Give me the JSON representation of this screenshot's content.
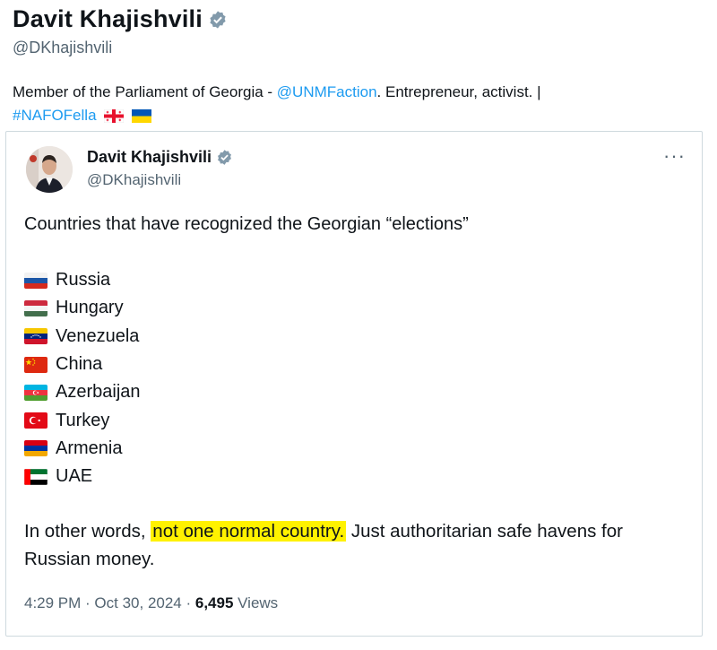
{
  "profile": {
    "name": "Davit Khajishvili",
    "handle": "@DKhajishvili",
    "bio_text1": "Member of the Parliament of Georgia - ",
    "bio_mention": "@UNMFaction",
    "bio_text2": ". Entrepreneur, activist. |",
    "bio_hashtag": "#NAFOFella"
  },
  "tweet": {
    "author_name": "Davit Khajishvili",
    "author_handle": "@DKhajishvili",
    "more_label": "···",
    "intro": "Countries that have recognized the Georgian “elections”",
    "countries": [
      {
        "name": "Russia",
        "flag": "russia-flag-icon"
      },
      {
        "name": "Hungary",
        "flag": "hungary-flag-icon"
      },
      {
        "name": "Venezuela",
        "flag": "venezuela-flag-icon"
      },
      {
        "name": "China",
        "flag": "china-flag-icon"
      },
      {
        "name": "Azerbaijan",
        "flag": "azerbaijan-flag-icon"
      },
      {
        "name": "Turkey",
        "flag": "turkey-flag-icon"
      },
      {
        "name": "Armenia",
        "flag": "armenia-flag-icon"
      },
      {
        "name": "UAE",
        "flag": "uae-flag-icon"
      }
    ],
    "closing_pre": "In other words, ",
    "closing_highlight": "not one normal country.",
    "closing_post": " Just authoritarian safe havens for Russian money.",
    "time": "4:29 PM · Oct 30, 2024 · ",
    "views_count": "6,495",
    "views_label": " Views"
  },
  "colors": {
    "link": "#1d9bf0",
    "highlight": "#fff200",
    "muted": "#536471",
    "verified": "#829aab"
  }
}
